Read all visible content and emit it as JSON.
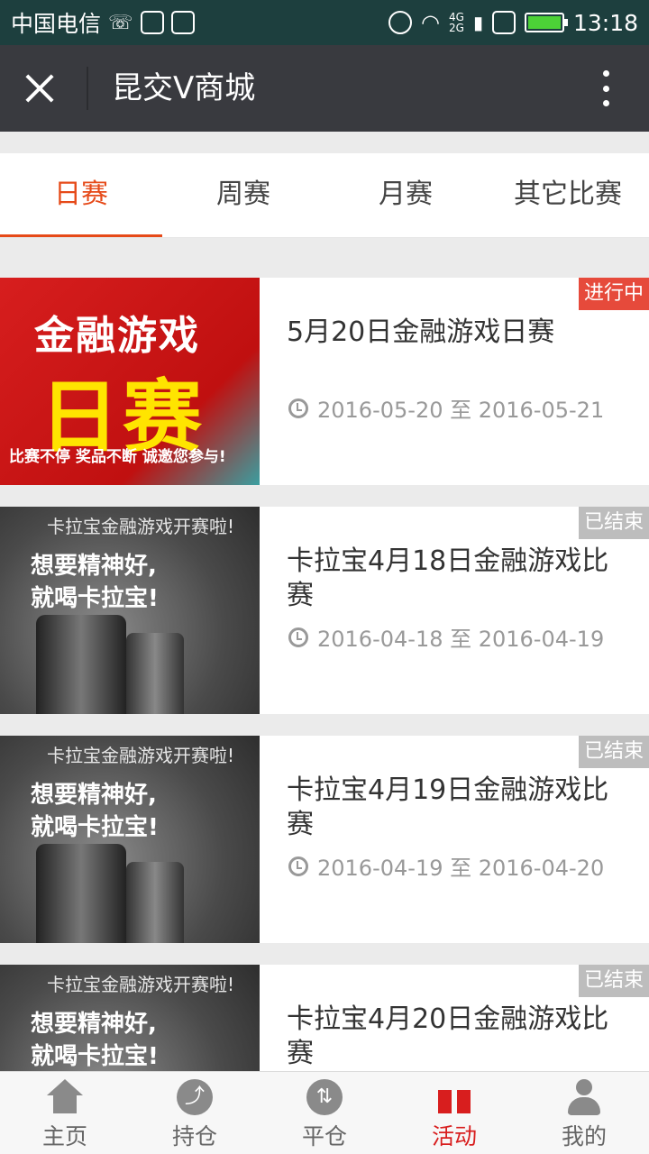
{
  "status_bar": {
    "carrier": "中国电信",
    "network_top": "4G",
    "network_bottom": "2G",
    "time": "13:18",
    "icons": [
      "missed-call-icon",
      "image-icon",
      "huawei-icon",
      "alarm-icon",
      "wifi-icon",
      "signal-icon",
      "sim-icon",
      "battery-icon"
    ]
  },
  "title_bar": {
    "title": "昆交V商城",
    "close_icon": "close-icon",
    "more_icon": "more-vertical-icon"
  },
  "tabs": [
    {
      "label": "日赛",
      "active": true
    },
    {
      "label": "周赛",
      "active": false
    },
    {
      "label": "月赛",
      "active": false
    },
    {
      "label": "其它比赛",
      "active": false
    }
  ],
  "colors": {
    "accent": "#e64a19",
    "status_active": "#e64a3b",
    "status_ended": "#bdbdbd",
    "nav_active": "#d81e1e"
  },
  "contests": [
    {
      "title": "5月20日金融游戏日赛",
      "date_range": "2016-05-20 至 2016-05-21",
      "status": "进行中",
      "thumb": {
        "line1": "金融游戏",
        "line2": "日赛",
        "line3": "比赛不停 奖品不断 诚邀您参与!"
      }
    },
    {
      "title": "卡拉宝4月18日金融游戏比赛",
      "date_range": "2016-04-18 至 2016-04-19",
      "status": "已结束",
      "thumb": {
        "line1": "卡拉宝金融游戏开赛啦!",
        "line2": "想要精神好,",
        "line3": "就喝卡拉宝!"
      }
    },
    {
      "title": "卡拉宝4月19日金融游戏比赛",
      "date_range": "2016-04-19 至 2016-04-20",
      "status": "已结束",
      "thumb": {
        "line1": "卡拉宝金融游戏开赛啦!",
        "line2": "想要精神好,",
        "line3": "就喝卡拉宝!"
      }
    },
    {
      "title": "卡拉宝4月20日金融游戏比赛",
      "date_range": "",
      "status": "已结束",
      "thumb": {
        "line1": "卡拉宝金融游戏开赛啦!",
        "line2": "想要精神好,",
        "line3": "就喝卡拉宝!"
      }
    }
  ],
  "bottom_nav": [
    {
      "label": "主页",
      "icon": "home-icon",
      "active": false
    },
    {
      "label": "持仓",
      "icon": "chart-trend-icon",
      "active": false
    },
    {
      "label": "平仓",
      "icon": "up-down-arrows-icon",
      "active": false
    },
    {
      "label": "活动",
      "icon": "gift-icon",
      "active": true
    },
    {
      "label": "我的",
      "icon": "user-icon",
      "active": false
    }
  ]
}
